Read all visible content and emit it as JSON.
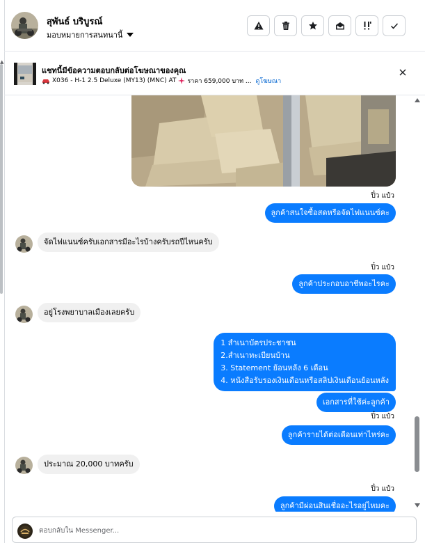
{
  "header": {
    "name": "สุพันธ์ บริบูรณ์",
    "assign_label": "มอบหมายการสนทนานี้",
    "toolbar": [
      {
        "icon": "warning-icon",
        "label": "spam"
      },
      {
        "icon": "trash-icon",
        "label": "delete"
      },
      {
        "icon": "star-icon",
        "label": "star"
      },
      {
        "icon": "mail-open-icon",
        "label": "mark-unread"
      },
      {
        "icon": "follow-up-icon",
        "label": "follow-up"
      },
      {
        "icon": "check-icon",
        "label": "done"
      }
    ]
  },
  "banner": {
    "title": "แชทนี้มีข้อความตอบกลับต่อโฆษณาของคุณ",
    "car_info": "X036 - H-1 2.5 Deluxe (MY13) (MNC) AT",
    "price": "ราคา 659,000 บาท ...",
    "link": "ดูโฆษณา"
  },
  "messages": {
    "ts1": "ปิ๋ว แป๋ว",
    "m1": "ลูกค้าสนใจซื้อสดหรือจัดไฟแนนซ์คะ",
    "m2": "จัดไฟแนนซ์ครับเอกสารมีอะไรบ้างครับรถปีไหนครับ",
    "ts2": "ปิ๋ว แป๋ว",
    "m3": "ลูกค้าประกอบอาชีพอะไรคะ",
    "m4": "อยู่โรงพยาบาลเมืองเลยครับ",
    "m5_lines": [
      "1 สำเนาบัตรประชาชน",
      "2.สำเนาทะเบียนบ้าน",
      " 3. Statement ย้อนหลัง 6 เดือน",
      "4. หนังสือรับรองเงินเดือนหรือสลิปเงินเดือนย้อนหลัง"
    ],
    "m6": "เอกสารที่ใช้ค่ะลูกค้า",
    "ts3": "ปิ๋ว แป๋ว",
    "m7": "ลูกค้ารายได้ต่อเดือนเท่าไหร่คะ",
    "m8": "ประมาณ 20,000 บาทครับ",
    "ts4": "ปิ๋ว แป๋ว",
    "m9": "ลูกค้ามีผ่อนสินเชื่ออะไรอยู่ไหมคะ"
  },
  "composer": {
    "placeholder": "ตอบกลับใน Messenger..."
  },
  "colors": {
    "outgoing_bubble": "#0a7cff",
    "incoming_bubble": "#f0f0f0",
    "link": "#0064d1"
  }
}
